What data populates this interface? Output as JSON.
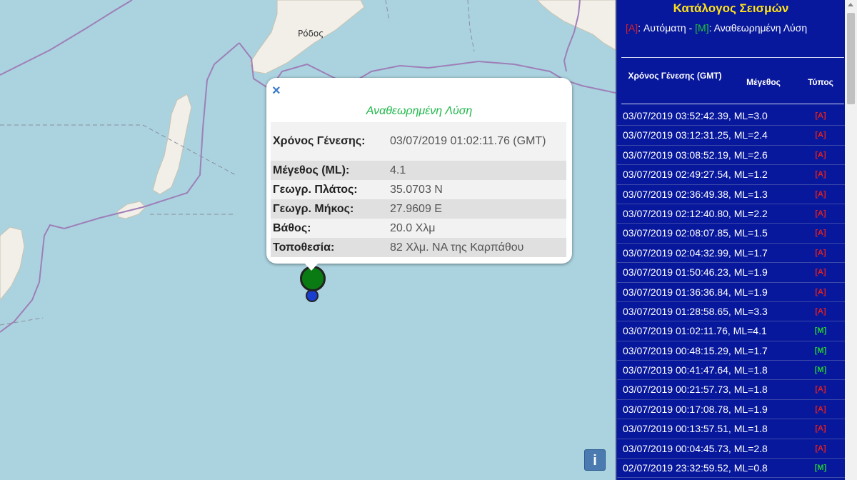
{
  "map": {
    "city_label": "Ρόδος",
    "colors": {
      "sea": "#aad3df",
      "land": "#f2efe9",
      "border": "#9e7fb8"
    },
    "info_icon": "i"
  },
  "popup": {
    "close_icon": "×",
    "heading": "Αναθεωρημένη Λύση",
    "rows": [
      {
        "label": "Χρόνος Γένεσης:",
        "value": "03/07/2019 01:02:11.76 (GMT)"
      },
      {
        "label": "Μέγεθος (ML):",
        "value": "4.1"
      },
      {
        "label": "Γεωγρ. Πλάτος:",
        "value": "35.0703 N"
      },
      {
        "label": "Γεωγρ. Μήκος:",
        "value": "27.9609 E"
      },
      {
        "label": "Βάθος:",
        "value": "20.0 Χλμ"
      },
      {
        "label": "Τοποθεσία:",
        "value": "82 Χλμ. ΝΑ της Καρπάθου"
      }
    ]
  },
  "panel": {
    "title": "Κατάλογος Σεισμών",
    "legend": {
      "auto_tag": "[A]",
      "auto_text": ": Αυτόματη - ",
      "manual_tag": "[M]",
      "manual_text": ": Αναθεωρημένη Λύση"
    },
    "headers": {
      "time": "Χρόνος Γένεσης (GMT)",
      "magnitude": "Μέγεθος",
      "type": "Τύπος"
    },
    "events": [
      {
        "text": "03/07/2019 03:52:42.39, ML=3.0",
        "type": "[A]",
        "kind": "A"
      },
      {
        "text": "03/07/2019 03:12:31.25, ML=2.4",
        "type": "[A]",
        "kind": "A"
      },
      {
        "text": "03/07/2019 03:08:52.19, ML=2.6",
        "type": "[A]",
        "kind": "A"
      },
      {
        "text": "03/07/2019 02:49:27.54, ML=1.2",
        "type": "[A]",
        "kind": "A"
      },
      {
        "text": "03/07/2019 02:36:49.38, ML=1.3",
        "type": "[A]",
        "kind": "A"
      },
      {
        "text": "03/07/2019 02:12:40.80, ML=2.2",
        "type": "[A]",
        "kind": "A"
      },
      {
        "text": "03/07/2019 02:08:07.85, ML=1.5",
        "type": "[A]",
        "kind": "A"
      },
      {
        "text": "03/07/2019 02:04:32.99, ML=1.7",
        "type": "[A]",
        "kind": "A"
      },
      {
        "text": "03/07/2019 01:50:46.23, ML=1.9",
        "type": "[A]",
        "kind": "A"
      },
      {
        "text": "03/07/2019 01:36:36.84, ML=1.9",
        "type": "[A]",
        "kind": "A"
      },
      {
        "text": "03/07/2019 01:28:58.65, ML=3.3",
        "type": "[A]",
        "kind": "A"
      },
      {
        "text": "03/07/2019 01:02:11.76, ML=4.1",
        "type": "[M]",
        "kind": "M"
      },
      {
        "text": "03/07/2019 00:48:15.29, ML=1.7",
        "type": "[M]",
        "kind": "M"
      },
      {
        "text": "03/07/2019 00:41:47.64, ML=1.8",
        "type": "[M]",
        "kind": "M"
      },
      {
        "text": "03/07/2019 00:21:57.73, ML=1.8",
        "type": "[A]",
        "kind": "A"
      },
      {
        "text": "03/07/2019 00:17:08.78, ML=1.9",
        "type": "[A]",
        "kind": "A"
      },
      {
        "text": "03/07/2019 00:13:57.51, ML=1.8",
        "type": "[A]",
        "kind": "A"
      },
      {
        "text": "03/07/2019 00:04:45.73, ML=2.8",
        "type": "[A]",
        "kind": "A"
      },
      {
        "text": "02/07/2019 23:32:59.52, ML=0.8",
        "type": "[M]",
        "kind": "M"
      }
    ]
  }
}
